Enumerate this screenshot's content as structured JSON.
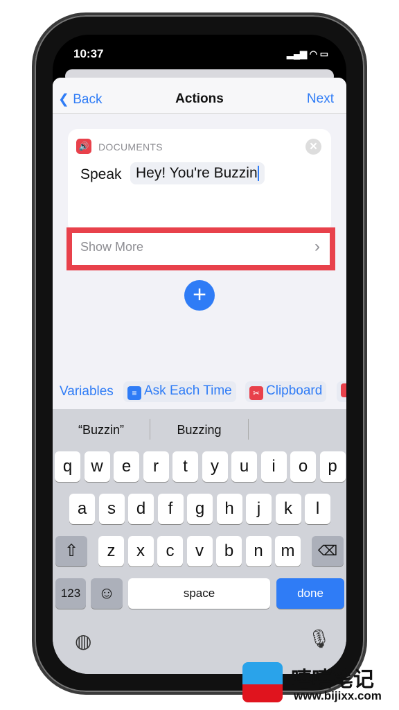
{
  "status": {
    "time": "10:37"
  },
  "nav": {
    "back": "Back",
    "title": "Actions",
    "next": "Next"
  },
  "action": {
    "category": "DOCUMENTS",
    "verb": "Speak",
    "text": "Hey! You're Buzzin",
    "show_more": "Show More"
  },
  "variables": {
    "label": "Variables",
    "chips": [
      "Ask Each Time",
      "Clipboard"
    ]
  },
  "keyboard": {
    "suggestions": [
      "“Buzzin”",
      "Buzzing",
      ""
    ],
    "row1": [
      "q",
      "w",
      "e",
      "r",
      "t",
      "y",
      "u",
      "i",
      "o",
      "p"
    ],
    "row2": [
      "a",
      "s",
      "d",
      "f",
      "g",
      "h",
      "j",
      "k",
      "l"
    ],
    "row3": [
      "z",
      "x",
      "c",
      "v",
      "b",
      "n",
      "m"
    ],
    "numbers": "123",
    "space": "space",
    "done": "done"
  },
  "watermark": {
    "title": "嘻嘻笔记",
    "url": "www.bijixx.com"
  },
  "colors": {
    "accent": "#2f7cf6",
    "highlight": "#e8414b"
  }
}
